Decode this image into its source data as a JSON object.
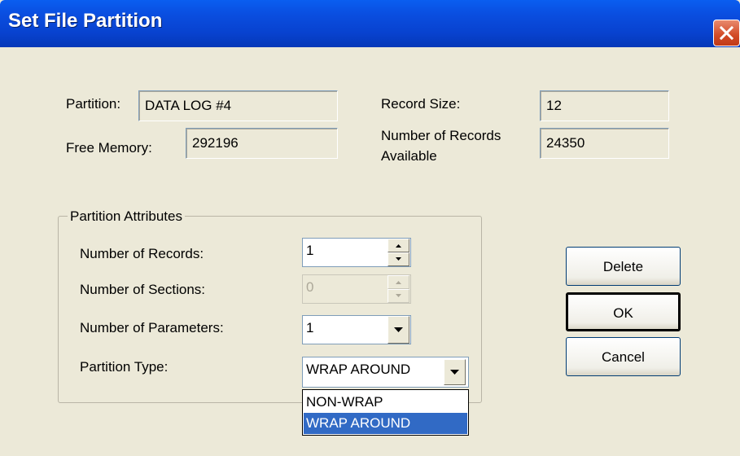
{
  "window": {
    "title": "Set File Partition"
  },
  "info": {
    "partition_label": "Partition:",
    "partition_value": "DATA LOG #4",
    "free_memory_label": "Free Memory:",
    "free_memory_value": "292196",
    "record_size_label": "Record Size:",
    "record_size_value": "12",
    "records_available_label_line1": "Number of Records",
    "records_available_label_line2": "Available",
    "records_available_value": "24350"
  },
  "attributes": {
    "legend": "Partition Attributes",
    "num_records_label": "Number of Records:",
    "num_records_value": "1",
    "num_sections_label": "Number of Sections:",
    "num_sections_value": "0",
    "num_parameters_label": "Number of Parameters:",
    "num_parameters_value": "1",
    "partition_type_label": "Partition Type:",
    "partition_type_value": "WRAP AROUND",
    "partition_type_options": [
      "NON-WRAP",
      "WRAP AROUND"
    ],
    "partition_type_highlighted": "WRAP AROUND"
  },
  "buttons": {
    "delete": "Delete",
    "ok": "OK",
    "cancel": "Cancel"
  },
  "icons": {
    "close": "close-icon",
    "spin_up": "arrow-up-icon",
    "spin_down": "arrow-down-icon",
    "dropdown": "chevron-down-icon"
  },
  "colors": {
    "titlebar": "#0842cf",
    "dialog_bg": "#ece9d8",
    "selection": "#316ac5",
    "close": "#d24a26"
  }
}
